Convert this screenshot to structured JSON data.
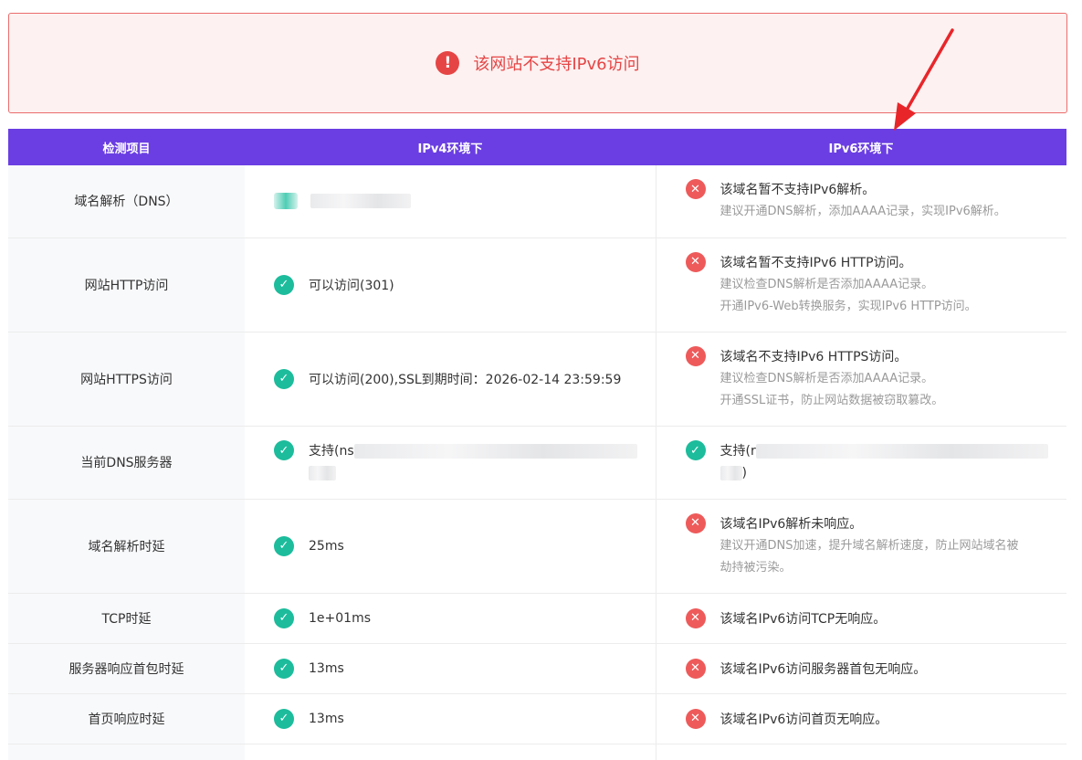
{
  "alert": {
    "message": "该网站不支持IPv6访问",
    "icon": "exclamation-circle-icon",
    "color": "#e64545"
  },
  "table": {
    "headers": [
      "检测项目",
      "IPv4环境下",
      "IPv6环境下"
    ],
    "header_bg": "#6a3ee2",
    "rows": [
      {
        "item": "域名解析（DNS）",
        "v4": {
          "status": "blurred",
          "main": ""
        },
        "v6": {
          "status": "error",
          "main": "该域名暂不支持IPv6解析。",
          "subs": [
            "建议开通DNS解析，添加AAAA记录，实现IPv6解析。"
          ]
        }
      },
      {
        "item": "网站HTTP访问",
        "v4": {
          "status": "ok",
          "main": "可以访问(301)"
        },
        "v6": {
          "status": "error",
          "main": "该域名暂不支持IPv6 HTTP访问。",
          "subs": [
            "建议检查DNS解析是否添加AAAA记录。",
            "开通IPv6-Web转换服务，实现IPv6 HTTP访问。"
          ]
        }
      },
      {
        "item": "网站HTTPS访问",
        "v4": {
          "status": "ok",
          "main": "可以访问(200),SSL到期时间：2026-02-14 23:59:59"
        },
        "v6": {
          "status": "error",
          "main": "该域名不支持IPv6 HTTPS访问。",
          "subs": [
            "建议检查DNS解析是否添加AAAA记录。",
            "开通SSL证书，防止网站数据被窃取篡改。"
          ]
        }
      },
      {
        "item": "当前DNS服务器",
        "v4": {
          "status": "ok",
          "main": "支持(ns"
        },
        "v6": {
          "status": "ok",
          "main": "支持(r",
          "tail": ")"
        }
      },
      {
        "item": "域名解析时延",
        "v4": {
          "status": "ok",
          "main": "25ms"
        },
        "v6": {
          "status": "error",
          "main": "该域名IPv6解析未响应。",
          "subs": [
            "建议开通DNS加速，提升域名解析速度，防止网站域名被",
            "劫持被污染。"
          ]
        }
      },
      {
        "item": "TCP时延",
        "v4": {
          "status": "ok",
          "main": "1e+01ms"
        },
        "v6": {
          "status": "error",
          "main": "该域名IPv6访问TCP无响应。"
        }
      },
      {
        "item": "服务器响应首包时延",
        "v4": {
          "status": "ok",
          "main": "13ms"
        },
        "v6": {
          "status": "error",
          "main": "该域名IPv6访问服务器首包无响应。"
        }
      },
      {
        "item": "首页响应时延",
        "v4": {
          "status": "ok",
          "main": "13ms"
        },
        "v6": {
          "status": "error",
          "main": "该域名IPv6访问首页无响应。"
        }
      }
    ]
  },
  "icons": {
    "ok": "check-circle-icon",
    "error": "x-circle-icon",
    "annotation": "red-arrow-annotation"
  },
  "colors": {
    "ok": "#1cbc9c",
    "error": "#ee5a5a",
    "arrow": "#e8262a"
  }
}
